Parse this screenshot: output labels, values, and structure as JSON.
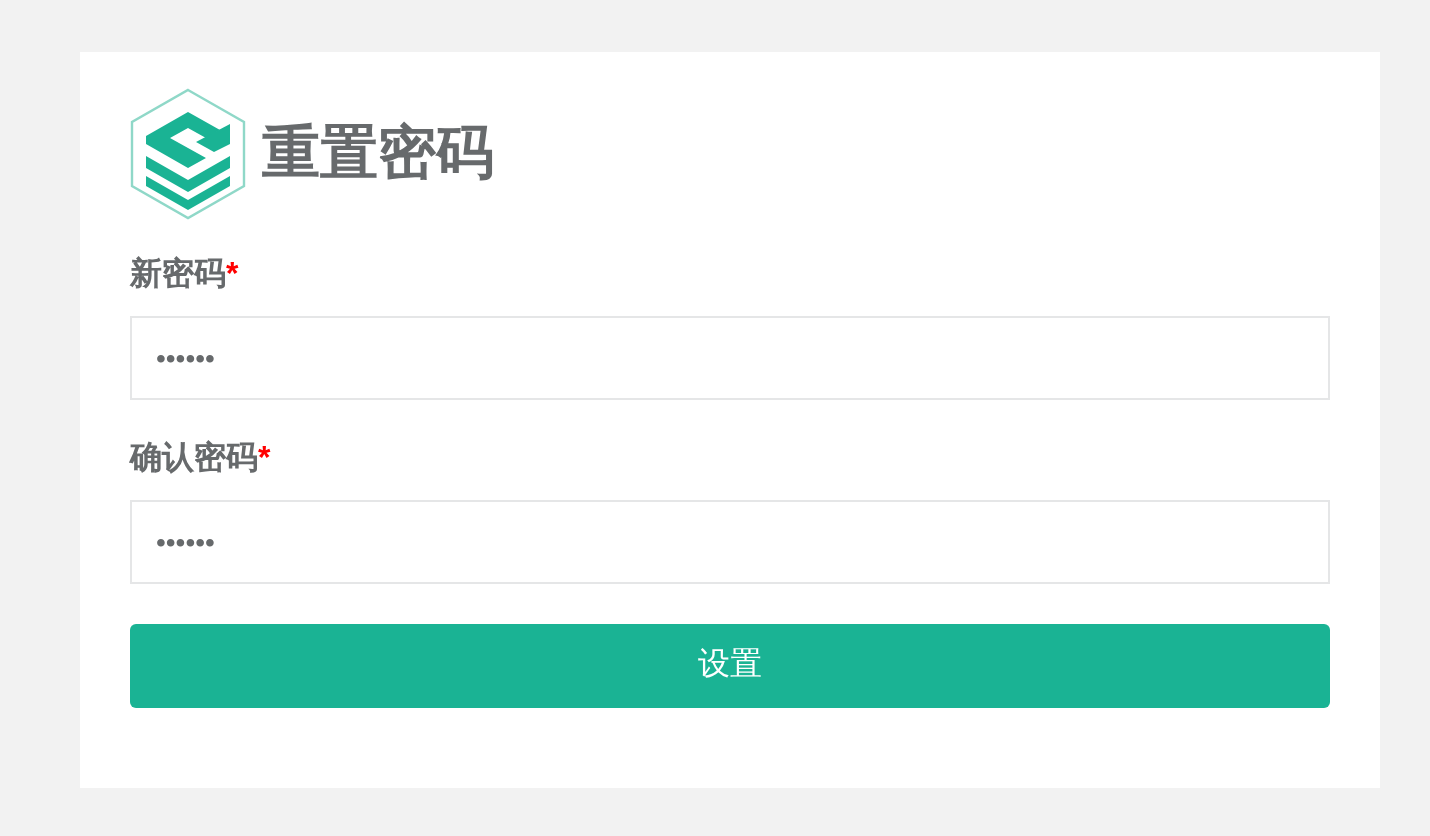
{
  "title": "重置密码",
  "fields": [
    {
      "label": "新密码",
      "required_mark": "*",
      "value": "••••••"
    },
    {
      "label": "确认密码",
      "required_mark": "*",
      "value": "••••••"
    }
  ],
  "submit_button": "设置"
}
